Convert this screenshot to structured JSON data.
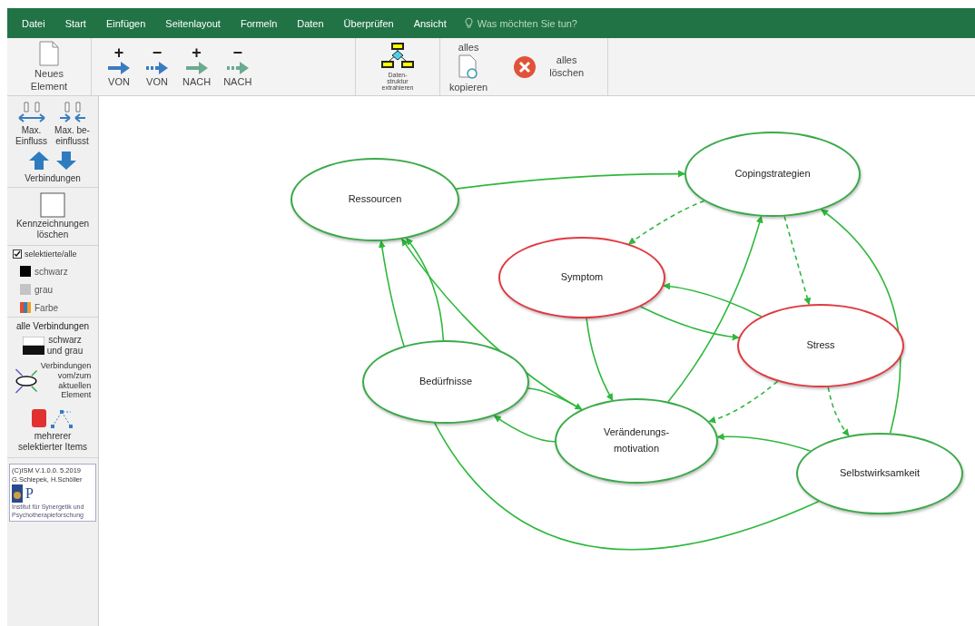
{
  "menu": {
    "tabs": [
      {
        "label": "Datei",
        "selected": false
      },
      {
        "label": "Start",
        "selected": false
      },
      {
        "label": "Einfügen",
        "selected": false
      },
      {
        "label": "Seitenlayout",
        "selected": false
      },
      {
        "label": "Formeln",
        "selected": false
      },
      {
        "label": "Daten",
        "selected": false
      },
      {
        "label": "Überprüfen",
        "selected": false
      },
      {
        "label": "Ansicht",
        "selected": false
      }
    ],
    "search": {
      "placeholder": "Was möchten Sie tun?"
    }
  },
  "ribbon": {
    "new_element": "Neues Element",
    "arrows": [
      {
        "sign": "+",
        "label": "VON",
        "kind": "solid"
      },
      {
        "sign": "−",
        "label": "VON",
        "kind": "dotted"
      },
      {
        "sign": "+",
        "label": "NACH",
        "kind": "solid"
      },
      {
        "sign": "−",
        "label": "NACH",
        "kind": "dotted"
      }
    ],
    "extract": "Daten-\nstruktur\nextrahieren",
    "copy_top": "alles",
    "copy_bottom": "kopieren",
    "delete": "alles\nlöschen"
  },
  "sidebar": {
    "max_influence": "Max.\nEinfluss",
    "max_influenced": "Max. be-\neinflusst",
    "connections": "Verbindungen",
    "clear_marks": "Kennzeichnungen\nlöschen",
    "selected_all": {
      "label": "selektierte/alle",
      "checked": true
    },
    "colors": [
      "schwarz",
      "grau",
      "Farbe"
    ],
    "all_connections": "alle Verbindungen",
    "black_grey": "schwarz\nund grau",
    "current_links": "Verbindungen\nvom/zum\naktuellen\nElement",
    "multi_selected": "mehrerer\nselektierter Items",
    "credits": [
      "(C)ISM V.1.0.0. 5.2019",
      "G.Schiepek, H.Schöller"
    ],
    "logo_letter": "P",
    "institute": "Institut für Synergetik und\nPsychotherapieforschung"
  },
  "diagram": {
    "nodes": [
      {
        "label": "Ressourcen",
        "color": "#3aaa48"
      },
      {
        "label": "Copingstrategien",
        "color": "#3aaa48"
      },
      {
        "label": "Symptom",
        "color": "#e03a40"
      },
      {
        "label": "Stress",
        "color": "#e03a40"
      },
      {
        "label": "Bedürfnisse",
        "color": "#3aaa48"
      },
      {
        "label": "Veränderungs-\nmotivation",
        "color": "#3aaa48"
      },
      {
        "label": "Selbstwirksamkeit",
        "color": "#3aaa48"
      }
    ],
    "edges": [
      {
        "dashed": false
      },
      {
        "dashed": true
      },
      {
        "dashed": true
      },
      {
        "dashed": false
      },
      {
        "dashed": false
      },
      {
        "dashed": false
      },
      {
        "dashed": true
      },
      {
        "dashed": true
      },
      {
        "dashed": false
      },
      {
        "dashed": false
      },
      {
        "dashed": false
      },
      {
        "dashed": false
      },
      {
        "dashed": false
      },
      {
        "dashed": false
      },
      {
        "dashed": false
      },
      {
        "dashed": false
      }
    ]
  }
}
